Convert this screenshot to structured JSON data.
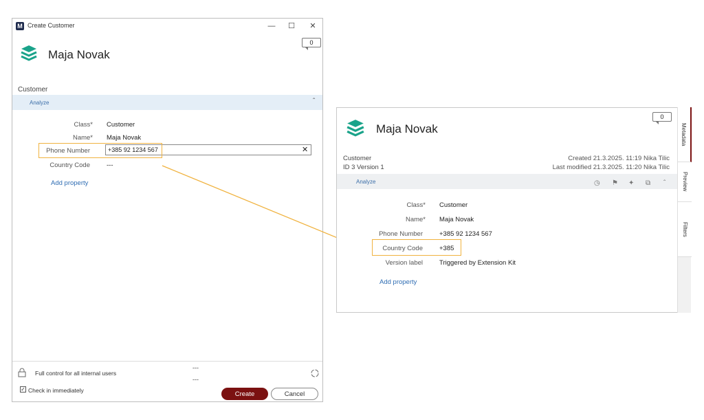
{
  "dialog": {
    "app_icon": "M",
    "window_title": "Create Customer",
    "comment_count": "0",
    "object_title": "Maja Novak",
    "class_caption": "Customer",
    "analyze_label": "Analyze",
    "properties": [
      {
        "label": "Class*",
        "value": "Customer"
      },
      {
        "label": "Name*",
        "value": "Maja Novak"
      },
      {
        "label": "Phone Number",
        "value": "+385 92 1234 567"
      },
      {
        "label": "Country Code",
        "value": "---"
      }
    ],
    "add_property": "Add property",
    "permissions": "Full control for all internal users",
    "footer_dash_1": "---",
    "footer_dash_2": "---",
    "check_in_label": "Check in immediately",
    "check_in_checked": true,
    "create_label": "Create",
    "cancel_label": "Cancel",
    "create_color": "#7b1111"
  },
  "card": {
    "comment_count": "0",
    "object_title": "Maja Novak",
    "class_caption": "Customer",
    "id_version": "ID 3  Version 1",
    "created": "Created 21.3.2025. 11:19 Nika Tilic",
    "last_modified": "Last modified 21.3.2025. 11:20 Nika Tilic",
    "analyze_label": "Analyze",
    "toolbar_icons": [
      "history-icon",
      "flag-icon",
      "pin-icon",
      "copy-icon",
      "chevron-up-icon"
    ],
    "properties": [
      {
        "label": "Class*",
        "value": "Customer"
      },
      {
        "label": "Name*",
        "value": "Maja Novak"
      },
      {
        "label": "Phone Number",
        "value": "+385 92 1234 567"
      },
      {
        "label": "Country Code",
        "value": "+385"
      },
      {
        "label": "Version label",
        "value": "Triggered by Extension Kit"
      }
    ],
    "add_property": "Add property",
    "side_tabs": [
      "Metadata",
      "Preview",
      "Filters"
    ]
  },
  "colors": {
    "highlight": "#f0b23e",
    "accent_teal": "#1aa38a",
    "link": "#2f6db3",
    "analyze_bg": "#e4eef7"
  }
}
